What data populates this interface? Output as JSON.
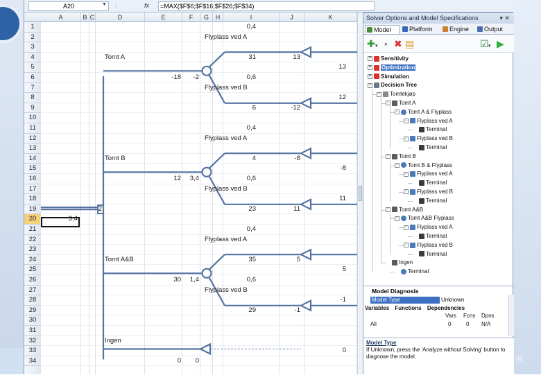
{
  "formula_bar": {
    "name_box": "A20",
    "fx": "fx",
    "formula": "=MAX($F$6;$F$16;$F$26;$F$34)"
  },
  "columns": [
    "A",
    "B",
    "C",
    "D",
    "E",
    "F",
    "G",
    "H",
    "I",
    "J",
    "K"
  ],
  "rows": [
    "1",
    "2",
    "3",
    "4",
    "5",
    "6",
    "7",
    "8",
    "9",
    "10",
    "11",
    "12",
    "13",
    "14",
    "15",
    "16",
    "17",
    "18",
    "19",
    "20",
    "21",
    "22",
    "23",
    "24",
    "25",
    "26",
    "27",
    "28",
    "29",
    "30",
    "31",
    "32",
    "33",
    "34"
  ],
  "selected_row": "20",
  "cells": {
    "prob_a1": "0,4",
    "branch_a1": "Flyplass ved A",
    "val_a1_i": "31",
    "val_a1_j": "13",
    "term_a1": "13",
    "node_a": "Tomt A",
    "cost_a": "-18",
    "ev_a": "-2",
    "prob_a2": "0,6",
    "branch_a2": "Flyplass ved B",
    "val_a2_i": "6",
    "val_a2_j": "-12",
    "term_a2": "12",
    "prob_b1": "0,4",
    "branch_b1": "Flyplass ved A",
    "val_b1_i": "4",
    "val_b1_j": "-8",
    "term_b1": "-8",
    "node_b": "Tomt B",
    "cost_b": "12",
    "ev_b": "3,4",
    "prob_b2": "0,6",
    "branch_b2": "Flyplass ved B",
    "val_b2_i": "23",
    "val_b2_j": "11",
    "term_b2": "11",
    "decision": "2",
    "root_ev": "3,4",
    "prob_c1": "0,4",
    "branch_c1": "Flyplass ved A",
    "val_c1_i": "35",
    "val_c1_j": "5",
    "term_c1": "5",
    "node_c": "Tomt A&B",
    "cost_c": "30",
    "ev_c": "1,4",
    "prob_c2": "0,6",
    "branch_c2": "Flyplass ved B",
    "val_c2_i": "29",
    "val_c2_j": "-1",
    "term_c2": "-1",
    "node_none": "Ingen",
    "cost_none": "0",
    "ev_none": "0",
    "term_none": "0"
  },
  "panel": {
    "title": "Solver Options and Model Specifications",
    "close": "▾ ✕",
    "tabs": [
      "Model",
      "Platform",
      "Engine",
      "Output"
    ],
    "toolbar": [
      "add",
      "remove",
      "delete",
      "copy",
      "analyze",
      "solve"
    ],
    "tree": [
      {
        "label": "Sensitivity",
        "depth": 0,
        "exp": "+",
        "bold": true
      },
      {
        "label": "Optimization",
        "depth": 0,
        "exp": "+",
        "bold": true,
        "selected": true
      },
      {
        "label": "Simulation",
        "depth": 0,
        "exp": "+",
        "bold": true
      },
      {
        "label": "Decision Tree",
        "depth": 0,
        "exp": "−",
        "bold": true
      },
      {
        "label": "Tomtekjøp",
        "depth": 1,
        "exp": "−"
      },
      {
        "label": "Tomt A",
        "depth": 2,
        "exp": "−"
      },
      {
        "label": "Tomt A & Flyplass",
        "depth": 3,
        "exp": "−"
      },
      {
        "label": "Flyplass ved A",
        "depth": 4,
        "exp": "−"
      },
      {
        "label": "Terminal",
        "depth": 5,
        "exp": ""
      },
      {
        "label": "Flyplass ved B",
        "depth": 4,
        "exp": "−"
      },
      {
        "label": "Terminal",
        "depth": 5,
        "exp": ""
      },
      {
        "label": "Tomt B",
        "depth": 2,
        "exp": "−"
      },
      {
        "label": "Tomt B & Flyplass",
        "depth": 3,
        "exp": "−"
      },
      {
        "label": "Flyplass ved A",
        "depth": 4,
        "exp": "−"
      },
      {
        "label": "Terminal",
        "depth": 5,
        "exp": ""
      },
      {
        "label": "Flyplass ved B",
        "depth": 4,
        "exp": "−"
      },
      {
        "label": "Terminal",
        "depth": 5,
        "exp": ""
      },
      {
        "label": "Tomt A&B",
        "depth": 2,
        "exp": "−"
      },
      {
        "label": "Tomt A&B Flyplass",
        "depth": 3,
        "exp": "−"
      },
      {
        "label": "Flyplass ved A",
        "depth": 4,
        "exp": "−"
      },
      {
        "label": "Terminal",
        "depth": 5,
        "exp": ""
      },
      {
        "label": "Flyplass ved B",
        "depth": 4,
        "exp": "−"
      },
      {
        "label": "Terminal",
        "depth": 5,
        "exp": ""
      },
      {
        "label": "Ingen",
        "depth": 2,
        "exp": ""
      },
      {
        "label": "Terminal",
        "depth": 3,
        "exp": ""
      }
    ],
    "diagnosis": {
      "header": "Model Diagnosis",
      "model_type_label": "Model Type",
      "model_type_value": "Unknown",
      "sub_tabs": [
        "Variables",
        "Functions",
        "Dependencies"
      ],
      "cols": [
        "Vars",
        "Fcns",
        "Dpns"
      ],
      "row_label": "All",
      "row_values": [
        "0",
        "0",
        "N/A"
      ]
    },
    "help": {
      "title": "Model Type",
      "text": "If Unknown, press the 'Analyze without Solving' button to diagnose the model."
    }
  },
  "slide": {
    "page_number": "32"
  }
}
